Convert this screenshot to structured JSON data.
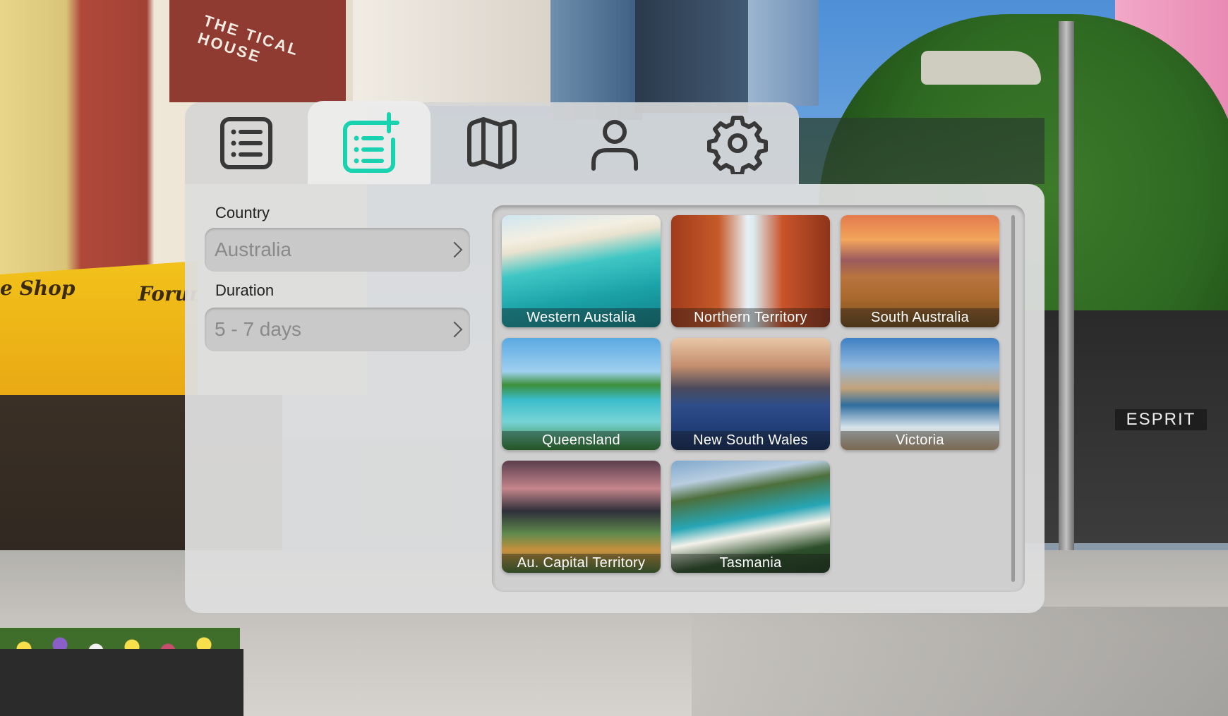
{
  "tabs": [
    {
      "icon": "list-icon",
      "active": false
    },
    {
      "icon": "add-list-icon",
      "active": true
    },
    {
      "icon": "map-icon",
      "active": false
    },
    {
      "icon": "profile-icon",
      "active": false
    },
    {
      "icon": "settings-icon",
      "active": false
    }
  ],
  "colors": {
    "accent": "#19d2b0",
    "icon": "#383838"
  },
  "form": {
    "country_label": "Country",
    "country_value": "Australia",
    "duration_label": "Duration",
    "duration_value": "5 - 7 days"
  },
  "regions": [
    {
      "name": "Western Austalia"
    },
    {
      "name": "Northern Territory"
    },
    {
      "name": "South Australia"
    },
    {
      "name": "Queensland"
    },
    {
      "name": "New South Wales"
    },
    {
      "name": "Victoria"
    },
    {
      "name": "Au. Capital Territory"
    },
    {
      "name": "Tasmania"
    }
  ],
  "background_signs": {
    "building": "THE TICAL HOUSE",
    "umbrella_left": "e Shop",
    "umbrella_right": "Forun",
    "store": "ESPRIT"
  }
}
